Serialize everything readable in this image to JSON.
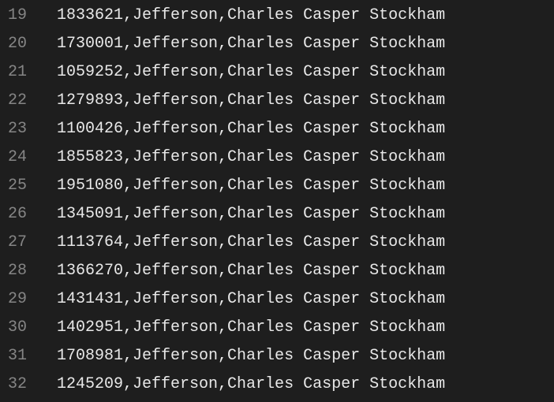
{
  "lines": [
    {
      "number": "19",
      "content": "1833621,Jefferson,Charles Casper Stockham"
    },
    {
      "number": "20",
      "content": "1730001,Jefferson,Charles Casper Stockham"
    },
    {
      "number": "21",
      "content": "1059252,Jefferson,Charles Casper Stockham"
    },
    {
      "number": "22",
      "content": "1279893,Jefferson,Charles Casper Stockham"
    },
    {
      "number": "23",
      "content": "1100426,Jefferson,Charles Casper Stockham"
    },
    {
      "number": "24",
      "content": "1855823,Jefferson,Charles Casper Stockham"
    },
    {
      "number": "25",
      "content": "1951080,Jefferson,Charles Casper Stockham"
    },
    {
      "number": "26",
      "content": "1345091,Jefferson,Charles Casper Stockham"
    },
    {
      "number": "27",
      "content": "1113764,Jefferson,Charles Casper Stockham"
    },
    {
      "number": "28",
      "content": "1366270,Jefferson,Charles Casper Stockham"
    },
    {
      "number": "29",
      "content": "1431431,Jefferson,Charles Casper Stockham"
    },
    {
      "number": "30",
      "content": "1402951,Jefferson,Charles Casper Stockham"
    },
    {
      "number": "31",
      "content": "1708981,Jefferson,Charles Casper Stockham"
    },
    {
      "number": "32",
      "content": "1245209,Jefferson,Charles Casper Stockham"
    }
  ]
}
